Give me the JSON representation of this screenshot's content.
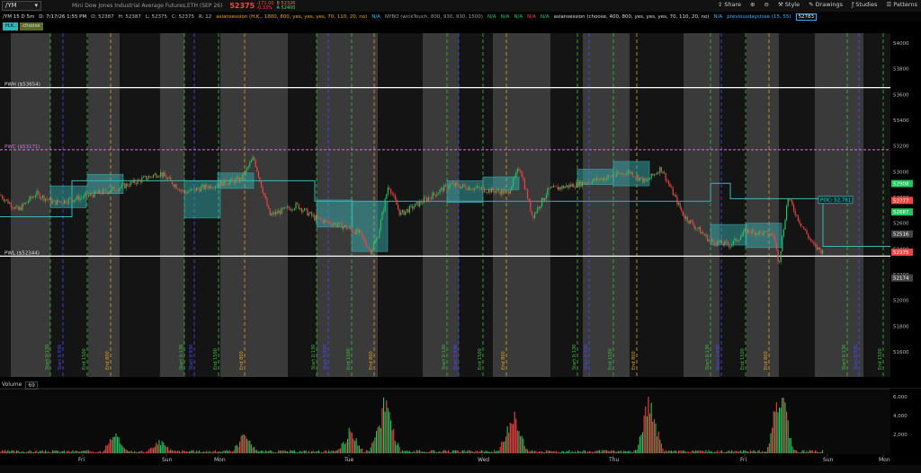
{
  "toolbar": {
    "symbol": "/YM",
    "description": "Mini Dow Jones Industrial Average Futures,ETH (SEP 26)",
    "price": "52375",
    "change": "-171.00",
    "change_pct": "-0.33%",
    "bid": "B 52326",
    "ask": "A 52400",
    "share": "Share",
    "style": "Style",
    "drawings": "Drawings",
    "studies": "Studies",
    "patterns": "Patterns"
  },
  "infobar": {
    "timeframe": "/YM 15 D 5m",
    "date": "D: 7/17/26 1:55 PM",
    "open": "O: 52387",
    "high": "H: 52387",
    "low": "L: 52375",
    "close": "C: 52375",
    "range": "R: 12",
    "study1": "asiansession (H.K., 1800, 800, yes, yes, yes, 70, 110, 20, no)",
    "na": "N/A",
    "study2": "NYBO (wickTouch, 800, 930, 930, 1500)",
    "study3": "asiansession (choose, 400, 800, yes, yes, yes, 70, 110, 20, no)",
    "study4": "previousdayclose (15, 55)",
    "study4_value": "52783"
  },
  "chips": {
    "hk": "H.K.",
    "choose": "choose"
  },
  "levels": {
    "pwh": "PWH ($53654)",
    "pwc": "PWC ($53171)",
    "pwl": "PWL ($52344)",
    "poc": "POC: 52,781"
  },
  "price_axis": {
    "ticks": [
      "54000",
      "53800",
      "53600",
      "53400",
      "53200",
      "53000",
      "52800",
      "52600",
      "52400",
      "52200",
      "52000",
      "51800",
      "51600"
    ],
    "badges": [
      "52908",
      "52777",
      "52687",
      "52516",
      "52375",
      "52174"
    ]
  },
  "session_labels": {
    "start": "Start 0:130",
    "end800": "End 800",
    "open_label": "Start 0:930",
    "close_label": "End 1500"
  },
  "volume": {
    "label": "Volume",
    "value": "69",
    "ticks": [
      "6,000",
      "4,000",
      "2,000"
    ]
  },
  "days": [
    "Fri",
    "Sun",
    "Mon",
    "Tue",
    "Wed",
    "Thu",
    "Fri",
    "Sun",
    "Mon"
  ],
  "colors": {
    "up": "#22c55e",
    "down": "#ef4444",
    "box": "#38b8b8",
    "pwc": "#e070e0"
  }
}
